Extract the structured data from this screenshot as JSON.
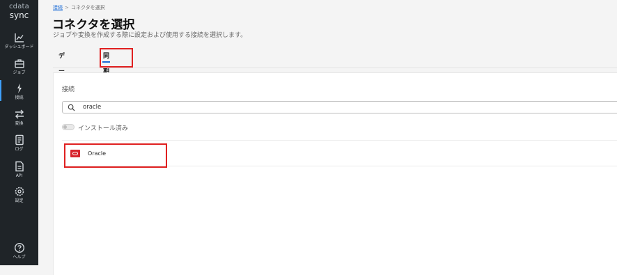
{
  "sidebar": {
    "brand": "cdata",
    "product": "sync",
    "items": [
      {
        "label": "ダッシュボード",
        "icon": "chart-line-icon"
      },
      {
        "label": "ジョブ",
        "icon": "briefcase-icon"
      },
      {
        "label": "接続",
        "icon": "plug-icon",
        "active": true
      },
      {
        "label": "変換",
        "icon": "arrows-exchange-icon"
      },
      {
        "label": "ログ",
        "icon": "document-list-icon"
      },
      {
        "label": "API",
        "icon": "api-document-icon"
      },
      {
        "label": "設定",
        "icon": "gear-icon"
      },
      {
        "label": "ヘルプ",
        "icon": "help-circle-icon"
      }
    ]
  },
  "breadcrumb": {
    "parent": "接続",
    "separator": ">",
    "current": "コネクタを選択"
  },
  "page": {
    "title": "コネクタを選択",
    "subtitle": "ジョブや変換を作成する際に設定および使用する接続を選択します。"
  },
  "tabs": [
    {
      "label": "データソース",
      "active": false
    },
    {
      "label": "同期先",
      "active": true
    }
  ],
  "connections": {
    "label": "接続",
    "search_value": "oracle",
    "toggle_label": "インストール済み",
    "toggle_on": false,
    "items": [
      {
        "name": "Oracle",
        "icon": "oracle-logo-icon"
      }
    ]
  },
  "colors": {
    "sidebar_bg": "#1f2428",
    "accent": "#1a6bd6",
    "highlight": "#e02020",
    "oracle_red": "#d7262e"
  }
}
